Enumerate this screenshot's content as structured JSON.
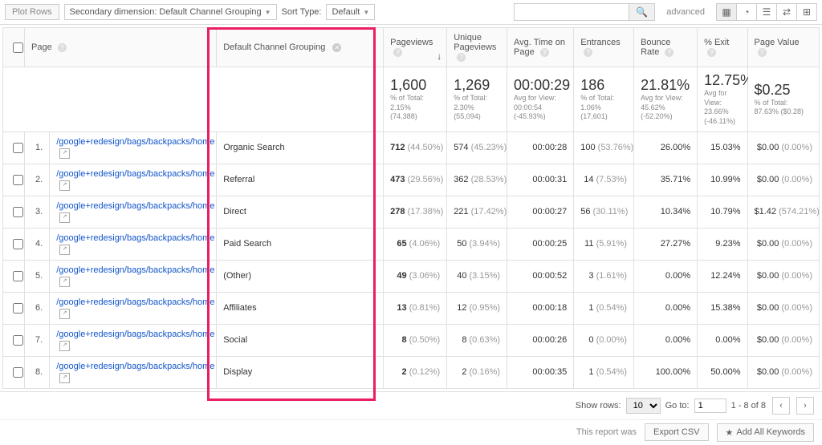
{
  "toolbar": {
    "plot_rows": "Plot Rows",
    "secondary_dim": "Secondary dimension: Default Channel Grouping",
    "sort_type_label": "Sort Type:",
    "sort_default": "Default",
    "advanced": "advanced"
  },
  "columns": {
    "page": "Page",
    "channel": "Default Channel Grouping",
    "pageviews": "Pageviews",
    "unique": "Unique Pageviews",
    "avg_time": "Avg. Time on Page",
    "entrances": "Entrances",
    "bounce": "Bounce Rate",
    "exit": "% Exit",
    "value": "Page Value"
  },
  "totals": {
    "pageviews": {
      "big": "1,600",
      "l1": "% of Total:",
      "l2": "2.15%",
      "l3": "(74,388)"
    },
    "unique": {
      "big": "1,269",
      "l1": "% of Total:",
      "l2": "2.30%",
      "l3": "(55,094)"
    },
    "avg_time": {
      "big": "00:00:29",
      "l1": "Avg for View:",
      "l2": "00:00:54",
      "l3": "(-45.93%)"
    },
    "entrances": {
      "big": "186",
      "l1": "% of Total:",
      "l2": "1.06%",
      "l3": "(17,601)"
    },
    "bounce": {
      "big": "21.81%",
      "l1": "Avg for View:",
      "l2": "45.62%",
      "l3": "(-52.20%)"
    },
    "exit": {
      "big": "12.75%",
      "l1": "Avg for View:",
      "l2": "23.66%",
      "l3": "(-46.11%)"
    },
    "value": {
      "big": "$0.25",
      "l1": "% of Total:",
      "l2": "87.63% ($0.28)",
      "l3": ""
    }
  },
  "rows": [
    {
      "idx": "1.",
      "page": "/google+redesign/bags/backpacks/home",
      "channel": "Organic Search",
      "pv": "712",
      "pvp": "(44.50%)",
      "up": "574",
      "upp": "(45.23%)",
      "tm": "00:00:28",
      "en": "100",
      "enp": "(53.76%)",
      "bn": "26.00%",
      "ex": "15.03%",
      "vl": "$0.00",
      "vlp": "(0.00%)"
    },
    {
      "idx": "2.",
      "page": "/google+redesign/bags/backpacks/home",
      "channel": "Referral",
      "pv": "473",
      "pvp": "(29.56%)",
      "up": "362",
      "upp": "(28.53%)",
      "tm": "00:00:31",
      "en": "14",
      "enp": "(7.53%)",
      "bn": "35.71%",
      "ex": "10.99%",
      "vl": "$0.00",
      "vlp": "(0.00%)"
    },
    {
      "idx": "3.",
      "page": "/google+redesign/bags/backpacks/home",
      "channel": "Direct",
      "pv": "278",
      "pvp": "(17.38%)",
      "up": "221",
      "upp": "(17.42%)",
      "tm": "00:00:27",
      "en": "56",
      "enp": "(30.11%)",
      "bn": "10.34%",
      "ex": "10.79%",
      "vl": "$1.42",
      "vlp": "(574.21%)"
    },
    {
      "idx": "4.",
      "page": "/google+redesign/bags/backpacks/home",
      "channel": "Paid Search",
      "pv": "65",
      "pvp": "(4.06%)",
      "up": "50",
      "upp": "(3.94%)",
      "tm": "00:00:25",
      "en": "11",
      "enp": "(5.91%)",
      "bn": "27.27%",
      "ex": "9.23%",
      "vl": "$0.00",
      "vlp": "(0.00%)"
    },
    {
      "idx": "5.",
      "page": "/google+redesign/bags/backpacks/home",
      "channel": "(Other)",
      "pv": "49",
      "pvp": "(3.06%)",
      "up": "40",
      "upp": "(3.15%)",
      "tm": "00:00:52",
      "en": "3",
      "enp": "(1.61%)",
      "bn": "0.00%",
      "ex": "12.24%",
      "vl": "$0.00",
      "vlp": "(0.00%)"
    },
    {
      "idx": "6.",
      "page": "/google+redesign/bags/backpacks/home",
      "channel": "Affiliates",
      "pv": "13",
      "pvp": "(0.81%)",
      "up": "12",
      "upp": "(0.95%)",
      "tm": "00:00:18",
      "en": "1",
      "enp": "(0.54%)",
      "bn": "0.00%",
      "ex": "15.38%",
      "vl": "$0.00",
      "vlp": "(0.00%)"
    },
    {
      "idx": "7.",
      "page": "/google+redesign/bags/backpacks/home",
      "channel": "Social",
      "pv": "8",
      "pvp": "(0.50%)",
      "up": "8",
      "upp": "(0.63%)",
      "tm": "00:00:26",
      "en": "0",
      "enp": "(0.00%)",
      "bn": "0.00%",
      "ex": "0.00%",
      "vl": "$0.00",
      "vlp": "(0.00%)"
    },
    {
      "idx": "8.",
      "page": "/google+redesign/bags/backpacks/home",
      "channel": "Display",
      "pv": "2",
      "pvp": "(0.12%)",
      "up": "2",
      "upp": "(0.16%)",
      "tm": "00:00:35",
      "en": "1",
      "enp": "(0.54%)",
      "bn": "100.00%",
      "ex": "50.00%",
      "vl": "$0.00",
      "vlp": "(0.00%)"
    }
  ],
  "pager": {
    "show_rows": "Show rows:",
    "rows_value": "10",
    "go_to": "Go to:",
    "go_value": "1",
    "range": "1 - 8 of 8"
  },
  "footer": {
    "report_was": "This report was",
    "export": "Export CSV",
    "add_all": "Add All Keywords"
  }
}
